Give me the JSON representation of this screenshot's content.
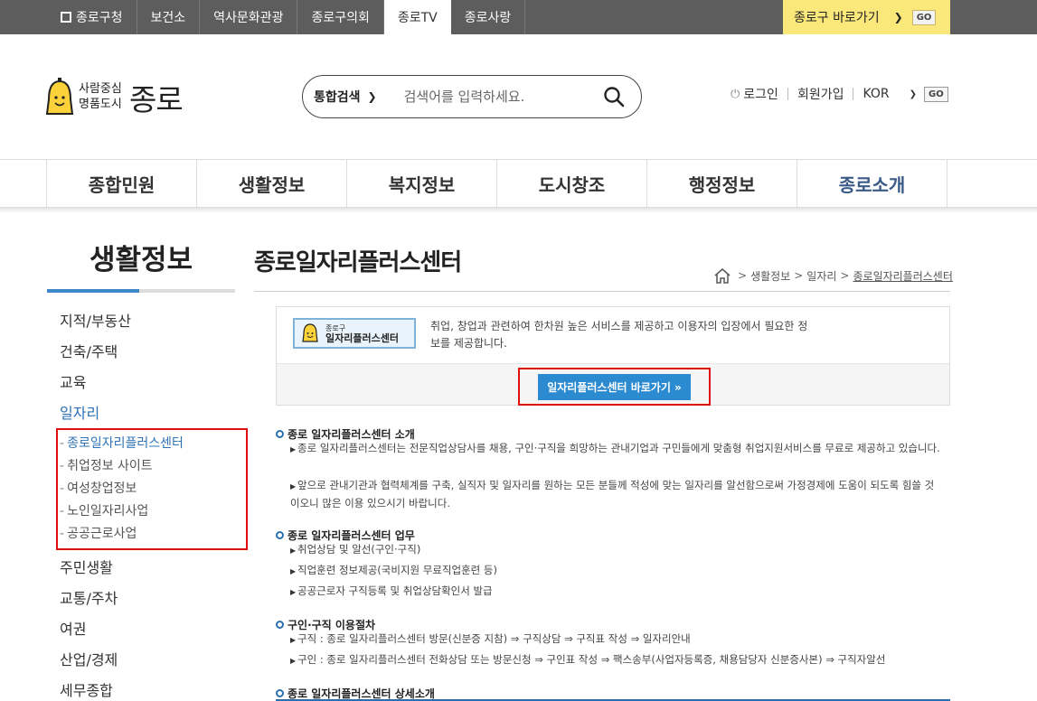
{
  "topbar": {
    "tabs": [
      "종로구청",
      "보건소",
      "역사문화관광",
      "종로구의회",
      "종로TV",
      "종로사랑"
    ],
    "quick_label": "종로구 바로가기",
    "quick_go": "GO"
  },
  "logo": {
    "slogan1": "사람중심",
    "slogan2": "명품도시",
    "name": "종로"
  },
  "search": {
    "scope": "통합검색",
    "placeholder": "검색어를 입력하세요."
  },
  "util": {
    "login": "로그인",
    "join": "회원가입",
    "lang": "KOR",
    "go": "GO"
  },
  "gnb": [
    "종합민원",
    "생활정보",
    "복지정보",
    "도시창조",
    "행정정보",
    "종로소개"
  ],
  "lnb": {
    "title": "생활정보",
    "items_top": [
      "지적/부동산",
      "건축/주택",
      "교육",
      "일자리"
    ],
    "subs": [
      "종로일자리플러스센터",
      "취업정보 사이트",
      "여성창업정보",
      "노인일자리사업",
      "공공근로사업"
    ],
    "items_bottom": [
      "주민생활",
      "교통/주차",
      "여권",
      "산업/경제",
      "세무종합"
    ]
  },
  "page": {
    "title": "종로일자리플러스센터",
    "breadcrumb": [
      "생활정보",
      "일자리",
      "종로일자리플러스센터"
    ]
  },
  "intro": {
    "banner_small": "종로구",
    "banner_big": "일자리플러스센터",
    "desc": "취업, 창업과 관련하여 한차원 높은 서비스를 제공하고 이용자의 입장에서 필요한 정보를 제공합니다.",
    "button": "일자리플러스센터 바로가기 »"
  },
  "sections": {
    "s1": {
      "heading": "종로 일자리플러스센터 소개",
      "items": [
        "종로 일자리플러스센터는 전문직업상담사를 채용, 구인·구직을 희망하는 관내기업과 구민들에게 맞춤형 취업지원서비스를 무료로 제공하고 있습니다.",
        "앞으로 관내기관과 협력체계를 구축, 실직자 및 일자리를 원하는 모든 분들께 적성에 맞는 일자리를 알선함으로써 가정경제에 도움이 되도록 힘쓸 것이오니 많은 이용 있으시기 바랍니다."
      ]
    },
    "s2": {
      "heading": "종로 일자리플러스센터 업무",
      "items": [
        "취업상담 및 알선(구인·구직)",
        "직업훈련 정보제공(국비지원 무료직업훈련 등)",
        "공공근로자 구직등록 및 취업상담확인서 발급"
      ]
    },
    "s3": {
      "heading": "구인·구직 이용절차",
      "items": [
        "구직 : 종로 일자리플러스센터 방문(신분증 지참) ⇒ 구직상담 ⇒ 구직표 작성 ⇒ 일자리안내",
        "구인 : 종로 일자리플러스센터 전화상담 또는 방문신청 ⇒ 구인표 작성 ⇒ 팩스송부(사업자등록증, 채용담당자 신분증사본) ⇒ 구직자알선"
      ]
    },
    "s4": {
      "heading": "종로 일자리플러스센터 상세소개"
    }
  }
}
